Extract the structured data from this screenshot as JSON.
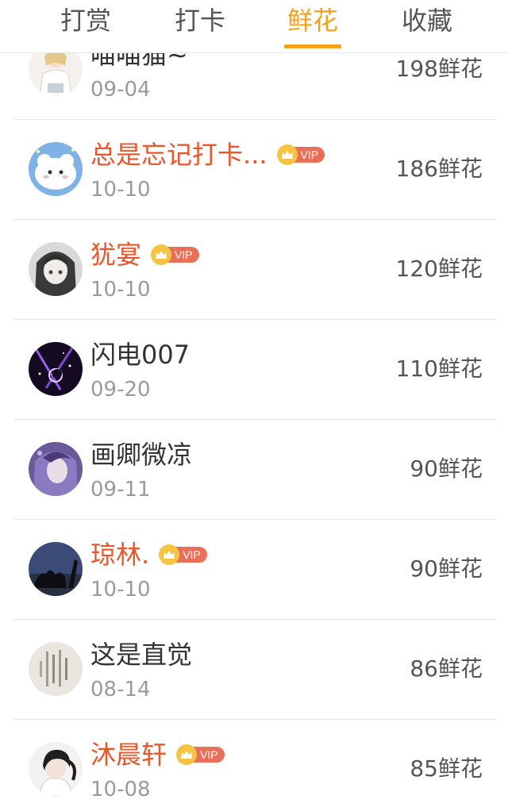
{
  "tabs": [
    {
      "label": "打赏",
      "active": false
    },
    {
      "label": "打卡",
      "active": false
    },
    {
      "label": "鲜花",
      "active": true
    },
    {
      "label": "收藏",
      "active": false
    }
  ],
  "colors": {
    "accent": "#f3a21a",
    "vip_name": "#e8562a",
    "vip_tag": "#e8705a",
    "crown": "#f6c343"
  },
  "vip_label": "VIP",
  "rows": [
    {
      "name": "喵喵猫~",
      "vip": false,
      "date": "09-04",
      "amount": "198鲜花",
      "avatar": "avatar-girl-white-dress"
    },
    {
      "name": "总是忘记打卡...",
      "vip": true,
      "date": "10-10",
      "amount": "186鲜花",
      "avatar": "avatar-cartoon-cat"
    },
    {
      "name": "犹宴",
      "vip": true,
      "date": "10-10",
      "amount": "120鲜花",
      "avatar": "avatar-anime-girl"
    },
    {
      "name": "闪电007",
      "vip": false,
      "date": "09-20",
      "amount": "110鲜花",
      "avatar": "avatar-galaxy"
    },
    {
      "name": "画卿微凉",
      "vip": false,
      "date": "09-11",
      "amount": "90鲜花",
      "avatar": "avatar-fantasy-portrait"
    },
    {
      "name": "琼林.",
      "vip": true,
      "date": "10-10",
      "amount": "90鲜花",
      "avatar": "avatar-night-silhouette"
    },
    {
      "name": "这是直觉",
      "vip": false,
      "date": "08-14",
      "amount": "86鲜花",
      "avatar": "avatar-calligraphy"
    },
    {
      "name": "沐晨轩",
      "vip": true,
      "date": "10-08",
      "amount": "85鲜花",
      "avatar": "avatar-girl-ponytail"
    }
  ]
}
